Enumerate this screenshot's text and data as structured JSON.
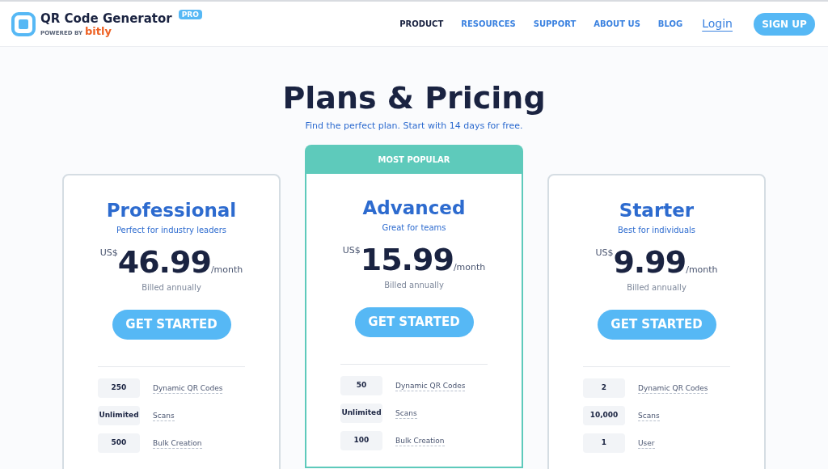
{
  "header": {
    "logo": {
      "title": "QR Code Generator",
      "badge": "PRO",
      "powered_by": "POWERED BY",
      "brand": "bitly"
    },
    "nav": [
      {
        "label": "PRODUCT",
        "selected": true
      },
      {
        "label": "RESOURCES",
        "selected": false
      },
      {
        "label": "SUPPORT",
        "selected": false
      },
      {
        "label": "ABOUT US",
        "selected": false
      },
      {
        "label": "BLOG",
        "selected": false
      }
    ],
    "login": "Login",
    "signup": "SIGN UP"
  },
  "title": "Plans & Pricing",
  "subtitle": "Find the perfect plan. Start with 14 days for free.",
  "plans": [
    {
      "name": "Professional",
      "tagline": "Perfect for industry leaders",
      "currency": "US$",
      "price": "46.99",
      "period": "/month",
      "billing": "Billed annually",
      "button": "GET STARTED",
      "features": [
        {
          "value": "250",
          "label": "Dynamic QR Codes"
        },
        {
          "value": "Unlimited",
          "label": "Scans"
        },
        {
          "value": "500",
          "label": "Bulk Creation"
        }
      ]
    },
    {
      "badge": "MOST POPULAR",
      "name": "Advanced",
      "tagline": "Great for teams",
      "currency": "US$",
      "price": "15.99",
      "period": "/month",
      "billing": "Billed annually",
      "button": "GET STARTED",
      "features": [
        {
          "value": "50",
          "label": "Dynamic QR Codes"
        },
        {
          "value": "Unlimited",
          "label": "Scans"
        },
        {
          "value": "100",
          "label": "Bulk Creation"
        }
      ]
    },
    {
      "name": "Starter",
      "tagline": "Best for individuals",
      "currency": "US$",
      "price": "9.99",
      "period": "/month",
      "billing": "Billed annually",
      "button": "GET STARTED",
      "features": [
        {
          "value": "2",
          "label": "Dynamic QR Codes"
        },
        {
          "value": "10,000",
          "label": "Scans"
        },
        {
          "value": "1",
          "label": "User"
        }
      ]
    }
  ]
}
